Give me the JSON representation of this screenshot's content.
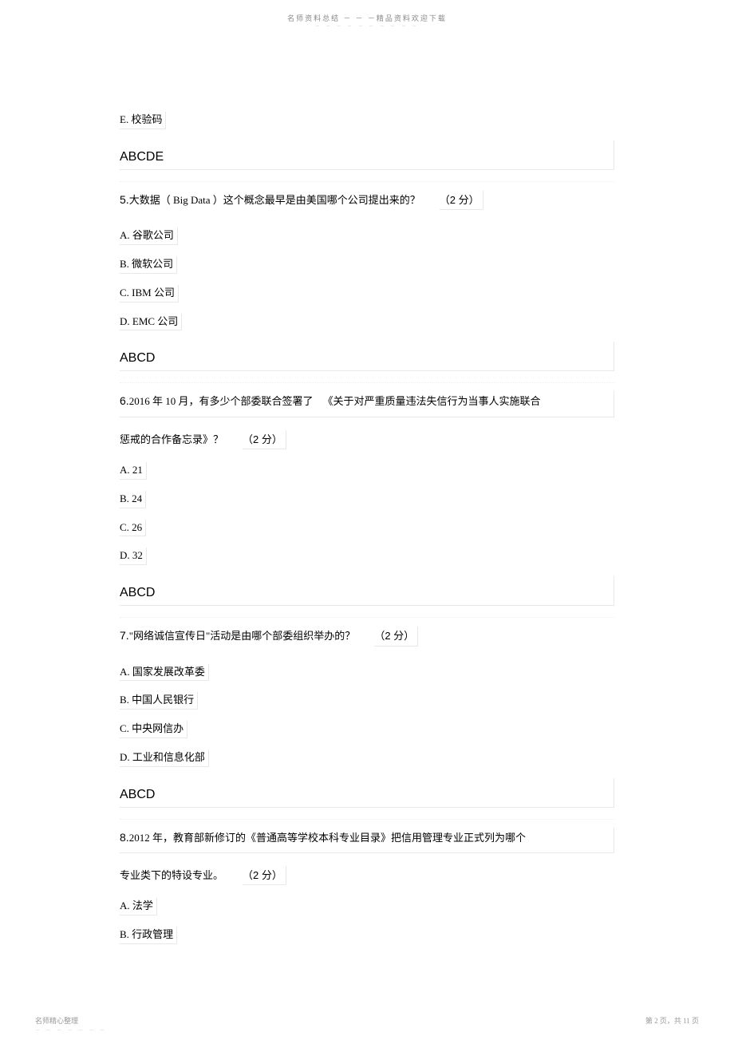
{
  "header": {
    "text": "名师资料总结 － － －精品资料欢迎下载",
    "dashes": "－ － － － － － － － － －"
  },
  "q4_tail": {
    "option_e": "E.  校验码",
    "answer": "ABCDE"
  },
  "q5": {
    "num": "5.",
    "text_a": "大数据（ Big Data  ）这个概念最早是由美国哪个公司提出来的？",
    "points": "（2  分）",
    "options": {
      "a": "A.  谷歌公司",
      "b": "B.  微软公司",
      "c": "C. IBM  公司",
      "d": "D. EMC 公司"
    },
    "answer": "ABCD"
  },
  "q6": {
    "num": "6.",
    "text_a": "2016 年 10 月，有多少个部委联合签署了",
    "text_b": "《关于对严重质量违法失信行为当事人实施联合",
    "text_c": "惩戒的合作备忘录》？",
    "points": "（2 分）",
    "options": {
      "a": "A. 21",
      "b": "B. 24",
      "c": "C. 26",
      "d": "D. 32"
    },
    "answer": "ABCD"
  },
  "q7": {
    "num": "7.",
    "text_a": "\"网络诚信宣传日\"活动是由哪个部委组织举办的？",
    "points": "（2  分）",
    "options": {
      "a": "A.  国家发展改革委",
      "b": "B.  中国人民银行",
      "c": "C.  中央网信办",
      "d": "D.  工业和信息化部"
    },
    "answer": "ABCD"
  },
  "q8": {
    "num": "8.",
    "text_a": "2012  年，教育部新修订的《普通高等学校本科专业目录》把信用管理专业正式列为哪个",
    "text_b": "专业类下的特设专业。",
    "points": "（2 分）",
    "options": {
      "a": "A.  法学",
      "b": "B.  行政管理"
    }
  },
  "footer": {
    "left": "名师精心整理",
    "left_dash": "－ － － － － － －",
    "right": "第 2 页，共 11 页"
  }
}
